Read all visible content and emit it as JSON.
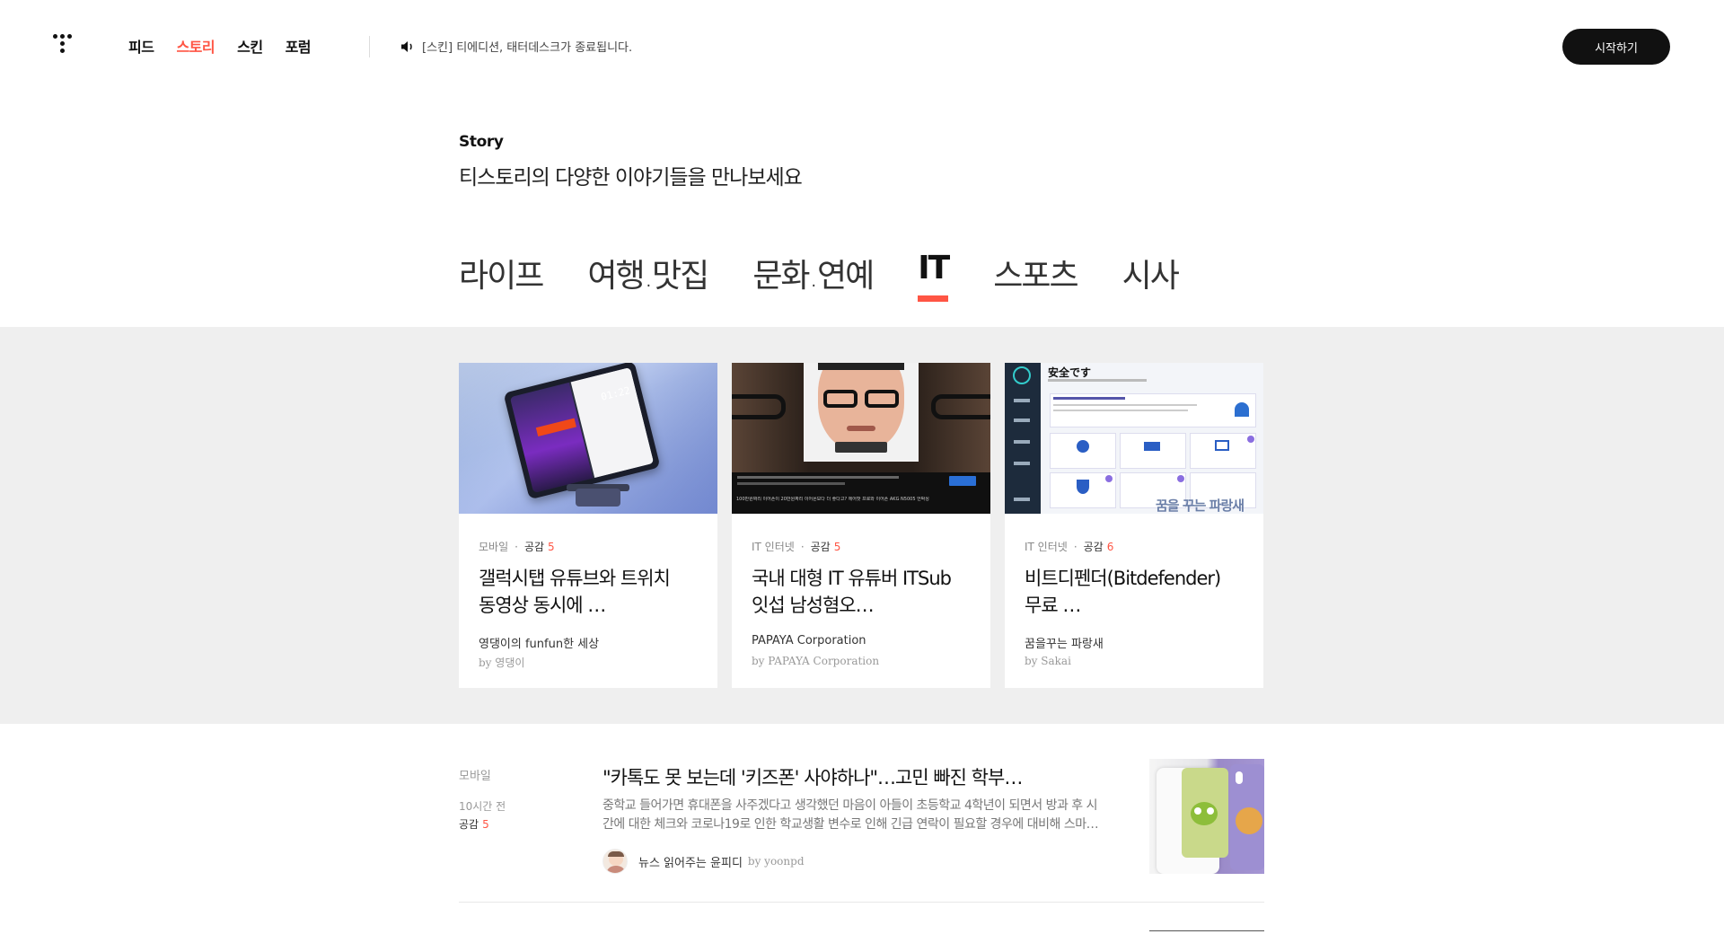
{
  "header": {
    "nav": [
      "피드",
      "스토리",
      "스킨",
      "포럼"
    ],
    "active_nav": "스토리",
    "notice": "[스킨] 티에디션, 태터데스크가 종료됩니다.",
    "start_button": "시작하기"
  },
  "intro": {
    "heading": "Story",
    "subheading": "티스토리의 다양한 이야기들을 만나보세요"
  },
  "categories": [
    "라이프",
    "여행.맛집",
    "문화.연예",
    "IT",
    "스포츠",
    "시사"
  ],
  "active_category": "IT",
  "featured": [
    {
      "category": "모바일",
      "like_label": "공감",
      "likes": "5",
      "title": "갤럭시탭 유튜브와 트위치 동영상 동시에 …",
      "blog": "영댕이의 funfun한 세상",
      "author": "by 영댕이",
      "thumb_text": "01:22"
    },
    {
      "category": "IT 인터넷",
      "like_label": "공감",
      "likes": "5",
      "title": "국내 대형 IT 유튜버 ITSub잇섭 남성혐오…",
      "blog": "PAPAYA Corporation",
      "author": "by PAPAYA Corporation",
      "thumb_text": "100만원짜리 이어폰이 20만원짜리 이어폰보다 더 좋다고? 에어팟 프로와 이어폰 AKG N5005 언박싱"
    },
    {
      "category": "IT 인터넷",
      "like_label": "공감",
      "likes": "6",
      "title": "비트디펜더(Bitdefender) 무료 …",
      "blog": "꿈을꾸는 파랑새",
      "author": "by Sakai",
      "thumb_text": "安全です",
      "thumb_watermark": "꿈을 꾸는 파랑새"
    }
  ],
  "list": [
    {
      "category": "모바일",
      "time": "10시간 전",
      "like_label": "공감",
      "likes": "5",
      "title": "\"카톡도 못 보는데 '키즈폰' 사야하나\"…고민 빠진 학부…",
      "excerpt": "중학교 들어가면 휴대폰을 사주겠다고 생각했던 마음이 아들이 초등학교 4학년이 되면서 방과 후 시간에 대한 체크와 코로나19로 인한 학교생활 변수로 인해 긴급 연락이 필요할 경우에 대비해 스마…",
      "blog": "뉴스 읽어주는 윤피디",
      "author": "by yoonpd"
    }
  ],
  "colors": {
    "accent": "#ff5544",
    "band_bg": "#efefef",
    "button_bg": "#111111"
  }
}
